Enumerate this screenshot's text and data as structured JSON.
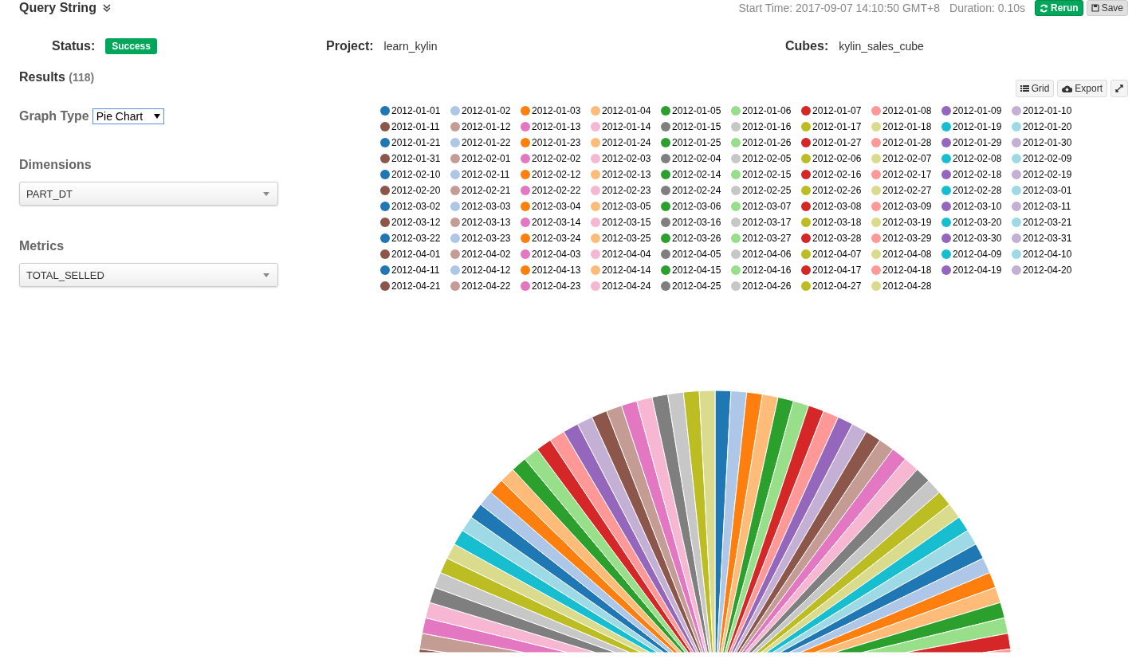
{
  "header": {
    "title": "Query String",
    "start_time": "Start Time: 2017-09-07 14:10:50 GMT+8",
    "duration": "Duration: 0.10s",
    "buttons": [
      {
        "label": "Rerun",
        "kind": "primary"
      },
      {
        "label": "Save",
        "kind": "default"
      }
    ]
  },
  "info": {
    "status_label": "Status:",
    "status": "Success",
    "project_label": "Project:",
    "project": "learn_kylin",
    "cubes_label": "Cubes:",
    "cubes": "kylin_sales_cube"
  },
  "results": {
    "label": "Results",
    "count": "(118)"
  },
  "toolbar": [
    {
      "label": "Grid",
      "kind": "grid"
    },
    {
      "label": "Export",
      "kind": "export"
    },
    {
      "kind": "expand"
    }
  ],
  "graph_type": {
    "label": "Graph Type",
    "value": "Pie Chart"
  },
  "dimensions": {
    "label": "Dimensions",
    "value": "PART_DT"
  },
  "metrics": {
    "label": "Metrics",
    "value": "TOTAL_SELLED"
  },
  "legend": [
    {
      "label": "2012-01-01",
      "color": "#1f77b4"
    },
    {
      "label": "2012-01-02",
      "color": "#aec7e8"
    },
    {
      "label": "2012-01-03",
      "color": "#ff7f0e"
    },
    {
      "label": "2012-01-04",
      "color": "#ffbb78"
    },
    {
      "label": "2012-01-05",
      "color": "#2ca02c"
    },
    {
      "label": "2012-01-06",
      "color": "#98df8a"
    },
    {
      "label": "2012-01-07",
      "color": "#d62728"
    },
    {
      "label": "2012-01-08",
      "color": "#ff9896"
    },
    {
      "label": "2012-01-09",
      "color": "#9467bd"
    },
    {
      "label": "2012-01-10",
      "color": "#c5b0d5"
    },
    {
      "label": "2012-01-11",
      "color": "#8c564b"
    },
    {
      "label": "2012-01-12",
      "color": "#c49c94"
    },
    {
      "label": "2012-01-13",
      "color": "#e377c2"
    },
    {
      "label": "2012-01-14",
      "color": "#f7b6d2"
    },
    {
      "label": "2012-01-15",
      "color": "#7f7f7f"
    },
    {
      "label": "2012-01-16",
      "color": "#c7c7c7"
    },
    {
      "label": "2012-01-17",
      "color": "#bcbd22"
    },
    {
      "label": "2012-01-18",
      "color": "#dbdb8d"
    },
    {
      "label": "2012-01-19",
      "color": "#17becf"
    },
    {
      "label": "2012-01-20",
      "color": "#9edae5"
    },
    {
      "label": "2012-01-21",
      "color": "#1f77b4"
    },
    {
      "label": "2012-01-22",
      "color": "#aec7e8"
    },
    {
      "label": "2012-01-23",
      "color": "#ff7f0e"
    },
    {
      "label": "2012-01-24",
      "color": "#ffbb78"
    },
    {
      "label": "2012-01-25",
      "color": "#2ca02c"
    },
    {
      "label": "2012-01-26",
      "color": "#98df8a"
    },
    {
      "label": "2012-01-27",
      "color": "#d62728"
    },
    {
      "label": "2012-01-28",
      "color": "#ff9896"
    },
    {
      "label": "2012-01-29",
      "color": "#9467bd"
    },
    {
      "label": "2012-01-30",
      "color": "#c5b0d5"
    },
    {
      "label": "2012-01-31",
      "color": "#8c564b"
    },
    {
      "label": "2012-02-01",
      "color": "#c49c94"
    },
    {
      "label": "2012-02-02",
      "color": "#e377c2"
    },
    {
      "label": "2012-02-03",
      "color": "#f7b6d2"
    },
    {
      "label": "2012-02-04",
      "color": "#7f7f7f"
    },
    {
      "label": "2012-02-05",
      "color": "#c7c7c7"
    },
    {
      "label": "2012-02-06",
      "color": "#bcbd22"
    },
    {
      "label": "2012-02-07",
      "color": "#dbdb8d"
    },
    {
      "label": "2012-02-08",
      "color": "#17becf"
    },
    {
      "label": "2012-02-09",
      "color": "#9edae5"
    },
    {
      "label": "2012-02-10",
      "color": "#1f77b4"
    },
    {
      "label": "2012-02-11",
      "color": "#aec7e8"
    },
    {
      "label": "2012-02-12",
      "color": "#ff7f0e"
    },
    {
      "label": "2012-02-13",
      "color": "#ffbb78"
    },
    {
      "label": "2012-02-14",
      "color": "#2ca02c"
    },
    {
      "label": "2012-02-15",
      "color": "#98df8a"
    },
    {
      "label": "2012-02-16",
      "color": "#d62728"
    },
    {
      "label": "2012-02-17",
      "color": "#ff9896"
    },
    {
      "label": "2012-02-18",
      "color": "#9467bd"
    },
    {
      "label": "2012-02-19",
      "color": "#c5b0d5"
    },
    {
      "label": "2012-02-20",
      "color": "#8c564b"
    },
    {
      "label": "2012-02-21",
      "color": "#c49c94"
    },
    {
      "label": "2012-02-22",
      "color": "#e377c2"
    },
    {
      "label": "2012-02-23",
      "color": "#f7b6d2"
    },
    {
      "label": "2012-02-24",
      "color": "#7f7f7f"
    },
    {
      "label": "2012-02-25",
      "color": "#c7c7c7"
    },
    {
      "label": "2012-02-26",
      "color": "#bcbd22"
    },
    {
      "label": "2012-02-27",
      "color": "#dbdb8d"
    },
    {
      "label": "2012-02-28",
      "color": "#17becf"
    },
    {
      "label": "2012-03-01",
      "color": "#9edae5"
    },
    {
      "label": "2012-03-02",
      "color": "#1f77b4"
    },
    {
      "label": "2012-03-03",
      "color": "#aec7e8"
    },
    {
      "label": "2012-03-04",
      "color": "#ff7f0e"
    },
    {
      "label": "2012-03-05",
      "color": "#ffbb78"
    },
    {
      "label": "2012-03-06",
      "color": "#2ca02c"
    },
    {
      "label": "2012-03-07",
      "color": "#98df8a"
    },
    {
      "label": "2012-03-08",
      "color": "#d62728"
    },
    {
      "label": "2012-03-09",
      "color": "#ff9896"
    },
    {
      "label": "2012-03-10",
      "color": "#9467bd"
    },
    {
      "label": "2012-03-11",
      "color": "#c5b0d5"
    },
    {
      "label": "2012-03-12",
      "color": "#8c564b"
    },
    {
      "label": "2012-03-13",
      "color": "#c49c94"
    },
    {
      "label": "2012-03-14",
      "color": "#e377c2"
    },
    {
      "label": "2012-03-15",
      "color": "#f7b6d2"
    },
    {
      "label": "2012-03-16",
      "color": "#7f7f7f"
    },
    {
      "label": "2012-03-17",
      "color": "#c7c7c7"
    },
    {
      "label": "2012-03-18",
      "color": "#bcbd22"
    },
    {
      "label": "2012-03-19",
      "color": "#dbdb8d"
    },
    {
      "label": "2012-03-20",
      "color": "#17becf"
    },
    {
      "label": "2012-03-21",
      "color": "#9edae5"
    },
    {
      "label": "2012-03-22",
      "color": "#1f77b4"
    },
    {
      "label": "2012-03-23",
      "color": "#aec7e8"
    },
    {
      "label": "2012-03-24",
      "color": "#ff7f0e"
    },
    {
      "label": "2012-03-25",
      "color": "#ffbb78"
    },
    {
      "label": "2012-03-26",
      "color": "#2ca02c"
    },
    {
      "label": "2012-03-27",
      "color": "#98df8a"
    },
    {
      "label": "2012-03-28",
      "color": "#d62728"
    },
    {
      "label": "2012-03-29",
      "color": "#ff9896"
    },
    {
      "label": "2012-03-30",
      "color": "#9467bd"
    },
    {
      "label": "2012-03-31",
      "color": "#c5b0d5"
    },
    {
      "label": "2012-04-01",
      "color": "#8c564b"
    },
    {
      "label": "2012-04-02",
      "color": "#c49c94"
    },
    {
      "label": "2012-04-03",
      "color": "#e377c2"
    },
    {
      "label": "2012-04-04",
      "color": "#f7b6d2"
    },
    {
      "label": "2012-04-05",
      "color": "#7f7f7f"
    },
    {
      "label": "2012-04-06",
      "color": "#c7c7c7"
    },
    {
      "label": "2012-04-07",
      "color": "#bcbd22"
    },
    {
      "label": "2012-04-08",
      "color": "#dbdb8d"
    },
    {
      "label": "2012-04-09",
      "color": "#17becf"
    },
    {
      "label": "2012-04-10",
      "color": "#9edae5"
    },
    {
      "label": "2012-04-11",
      "color": "#1f77b4"
    },
    {
      "label": "2012-04-12",
      "color": "#aec7e8"
    },
    {
      "label": "2012-04-13",
      "color": "#ff7f0e"
    },
    {
      "label": "2012-04-14",
      "color": "#ffbb78"
    },
    {
      "label": "2012-04-15",
      "color": "#2ca02c"
    },
    {
      "label": "2012-04-16",
      "color": "#98df8a"
    },
    {
      "label": "2012-04-17",
      "color": "#d62728"
    },
    {
      "label": "2012-04-18",
      "color": "#ff9896"
    },
    {
      "label": "2012-04-19",
      "color": "#9467bd"
    },
    {
      "label": "2012-04-20",
      "color": "#c5b0d5"
    },
    {
      "label": "2012-04-21",
      "color": "#8c564b"
    },
    {
      "label": "2012-04-22",
      "color": "#c49c94"
    },
    {
      "label": "2012-04-23",
      "color": "#e377c2"
    },
    {
      "label": "2012-04-24",
      "color": "#f7b6d2"
    },
    {
      "label": "2012-04-25",
      "color": "#7f7f7f"
    },
    {
      "label": "2012-04-26",
      "color": "#c7c7c7"
    },
    {
      "label": "2012-04-27",
      "color": "#bcbd22"
    },
    {
      "label": "2012-04-28",
      "color": "#dbdb8d"
    }
  ]
}
